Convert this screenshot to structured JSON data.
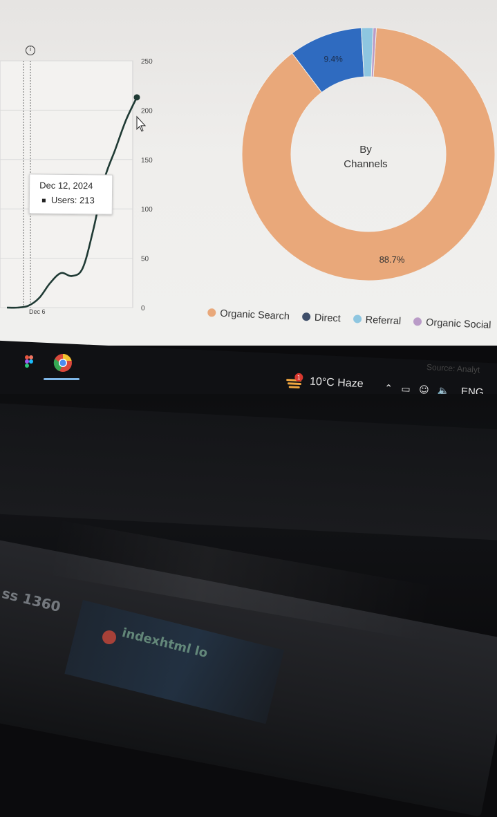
{
  "line_chart": {
    "tooltip": {
      "date": "Dec 12, 2024",
      "metric_label": "Users: 213"
    },
    "info_glyph": "i"
  },
  "donut_chart": {
    "center_label": "By\nChannels",
    "slice_labels": [
      "88.7%",
      "9.4%"
    ]
  },
  "legend": {
    "items": [
      {
        "label": "Organic Search",
        "color": "#e9a87a"
      },
      {
        "label": "Direct",
        "color": "#3f4f6a"
      },
      {
        "label": "Referral",
        "color": "#8ec6e0"
      },
      {
        "label": "Organic Social",
        "color": "#b99bc7"
      }
    ]
  },
  "source_note": "Source: Analyt",
  "taskbar": {
    "weather": "10°C  Haze",
    "weather_badge": "1",
    "language": "ENG",
    "tray_icons": [
      "chevron-up-icon",
      "battery-icon",
      "wifi-icon",
      "speaker-icon"
    ]
  },
  "desk_blur_text": {
    "line1": "ss 1360",
    "line2": "indexhtml lo"
  },
  "chart_data": [
    {
      "type": "line",
      "title": "",
      "xlabel": "",
      "ylabel": "",
      "x_ticks": [
        "Dec 6"
      ],
      "y_ticks": [
        0,
        50,
        100,
        150,
        200,
        250
      ],
      "ylim": [
        0,
        250
      ],
      "grid": true,
      "series": [
        {
          "x": [
            0,
            1,
            2,
            3,
            4,
            5,
            6,
            7,
            8,
            9,
            10,
            11,
            12
          ],
          "values": [
            0,
            0,
            2,
            10,
            25,
            35,
            32,
            40,
            80,
            130,
            160,
            190,
            213
          ]
        }
      ],
      "highlight": {
        "x": "Dec 12, 2024",
        "value": 213
      }
    },
    {
      "type": "pie",
      "donut": true,
      "center_text": "By Channels",
      "categories": [
        "Organic Search",
        "Direct",
        "Referral",
        "Organic Social"
      ],
      "values": [
        88.7,
        9.4,
        1.5,
        0.4
      ],
      "colors": [
        "#e9a87a",
        "#2f6bc0",
        "#8ec6e0",
        "#b99bc7"
      ]
    }
  ]
}
